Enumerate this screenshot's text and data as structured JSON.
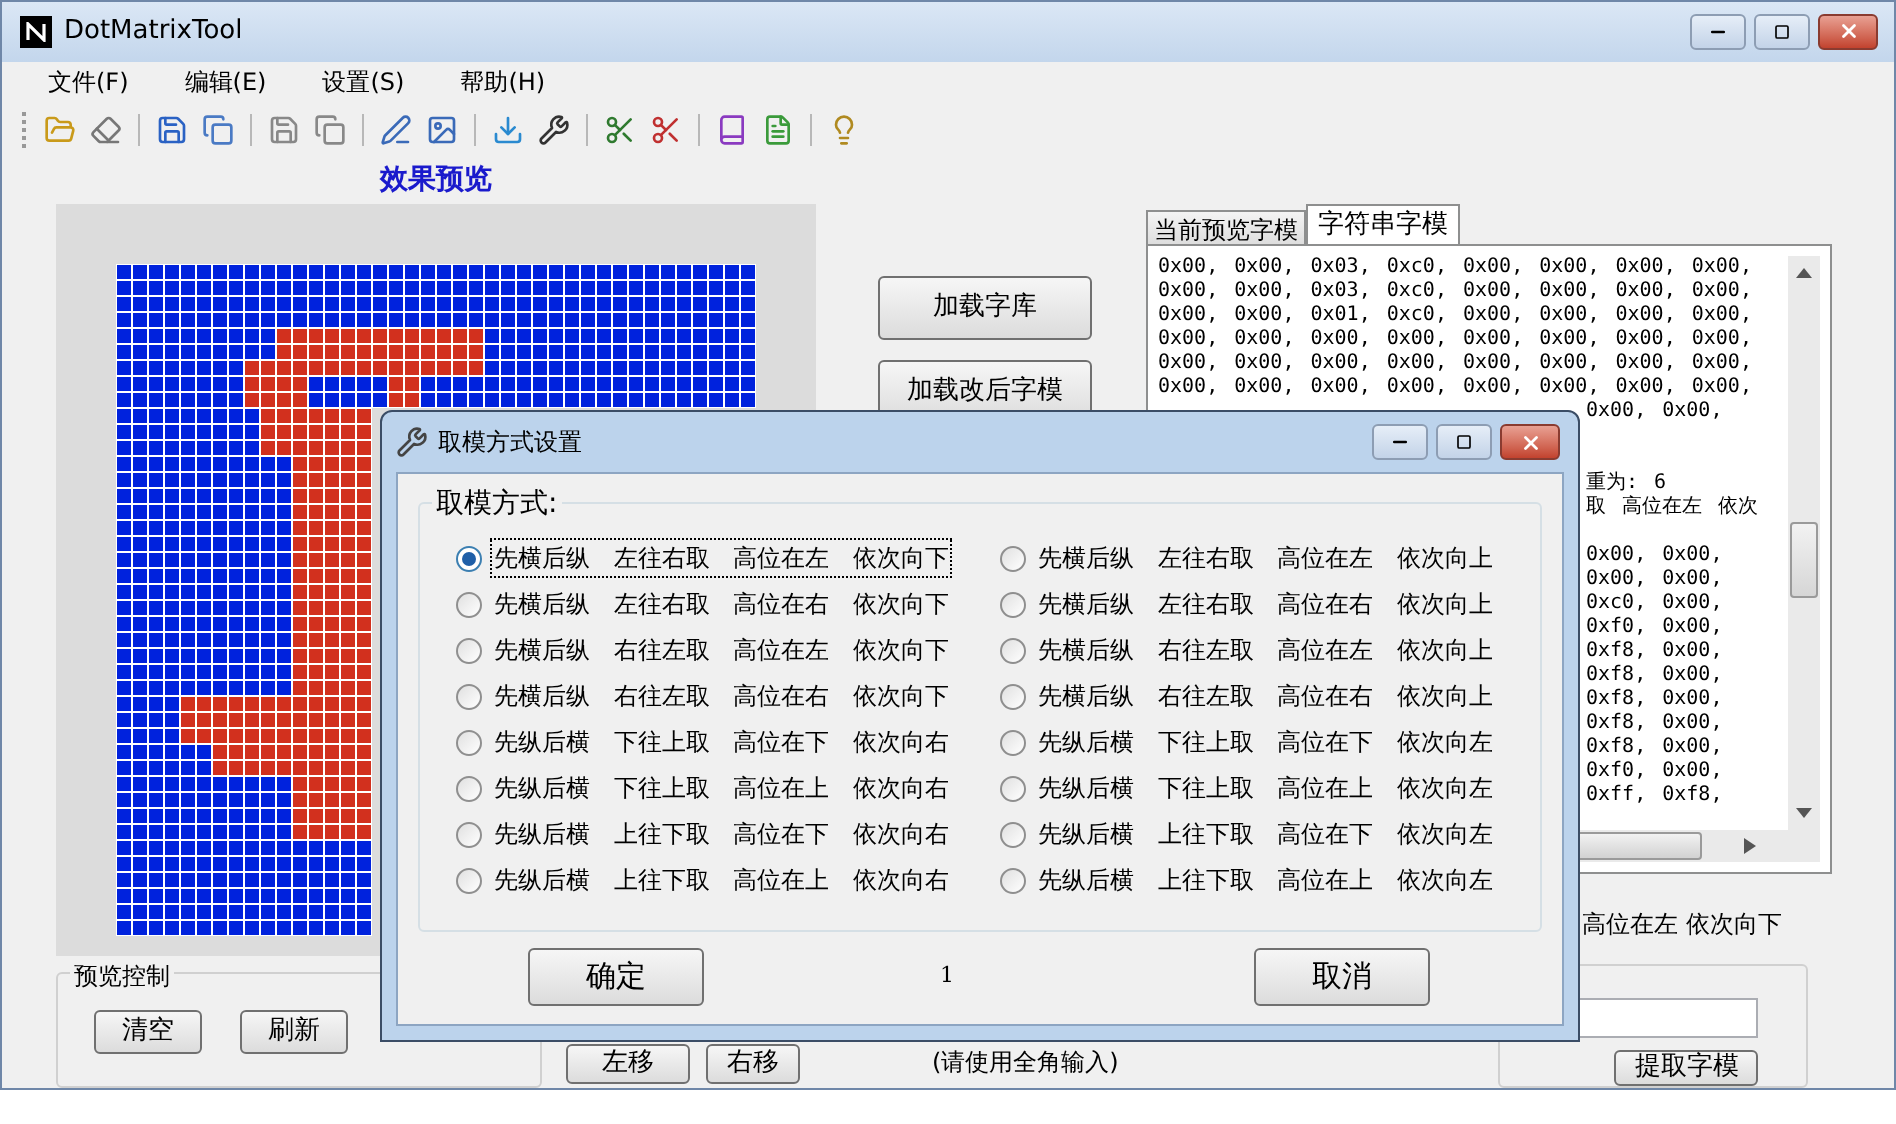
{
  "window": {
    "title": "DotMatrixTool"
  },
  "menu": [
    {
      "label": "文件(F)"
    },
    {
      "label": "编辑(E)"
    },
    {
      "label": "设置(S)"
    },
    {
      "label": "帮助(H)"
    }
  ],
  "preview": {
    "title": "效果预览"
  },
  "side_buttons": [
    "加载字库",
    "加载改后字模"
  ],
  "tabs": [
    {
      "label": "当前预览字模",
      "selected": false
    },
    {
      "label": "字符串字模",
      "selected": true
    }
  ],
  "output_lines": [
    {
      "kind": "full",
      "text": "0x00, 0x00, 0x03, 0xc0, 0x00, 0x00, 0x00, 0x00,"
    },
    {
      "kind": "full",
      "text": "0x00, 0x00, 0x03, 0xc0, 0x00, 0x00, 0x00, 0x00,"
    },
    {
      "kind": "full",
      "text": "0x00, 0x00, 0x01, 0xc0, 0x00, 0x00, 0x00, 0x00,"
    },
    {
      "kind": "full",
      "text": "0x00, 0x00, 0x00, 0x00, 0x00, 0x00, 0x00, 0x00,"
    },
    {
      "kind": "full",
      "text": "0x00, 0x00, 0x00, 0x00, 0x00, 0x00, 0x00, 0x00,"
    },
    {
      "kind": "full",
      "text": "0x00, 0x00, 0x00, 0x00, 0x00, 0x00, 0x00, 0x00,"
    },
    {
      "kind": "tail",
      "text": "0x00, 0x00,"
    },
    {
      "kind": "gap"
    },
    {
      "kind": "gap"
    },
    {
      "kind": "tail",
      "text": "重为: 6"
    },
    {
      "kind": "tail",
      "text": "取 高位在左 依次"
    },
    {
      "kind": "gap"
    },
    {
      "kind": "tail",
      "text": "0x00, 0x00,"
    },
    {
      "kind": "tail",
      "text": "0x00, 0x00,"
    },
    {
      "kind": "tail",
      "text": "0xc0, 0x00,"
    },
    {
      "kind": "tail",
      "text": "0xf0, 0x00,"
    },
    {
      "kind": "tail",
      "text": "0xf8, 0x00,"
    },
    {
      "kind": "tail",
      "text": "0xf8, 0x00,"
    },
    {
      "kind": "tail",
      "text": "0xf8, 0x00,"
    },
    {
      "kind": "tail",
      "text": "0xf8, 0x00,"
    },
    {
      "kind": "tail",
      "text": "0xf8, 0x00,"
    },
    {
      "kind": "tail",
      "text": "0xf0, 0x00,"
    },
    {
      "kind": "tail",
      "text": "0xff, 0xf8,"
    }
  ],
  "status_text": "高位在左 依次向下",
  "preview_control": {
    "title": "预览控制",
    "buttons": [
      "清空",
      "刷新"
    ]
  },
  "shift_buttons": [
    "左移",
    "右移"
  ],
  "hint": "(请使用全角输入)",
  "extract_button": "提取字模",
  "dialog": {
    "title": "取模方式设置",
    "group_title": "取模方式:",
    "options": [
      {
        "label": "先横后纵 左往右取 高位在左 依次向下",
        "selected": true
      },
      {
        "label": "先横后纵 左往右取 高位在左 依次向上",
        "selected": false
      },
      {
        "label": "先横后纵 左往右取 高位在右 依次向下",
        "selected": false
      },
      {
        "label": "先横后纵 左往右取 高位在右 依次向上",
        "selected": false
      },
      {
        "label": "先横后纵 右往左取 高位在左 依次向下",
        "selected": false
      },
      {
        "label": "先横后纵 右往左取 高位在左 依次向上",
        "selected": false
      },
      {
        "label": "先横后纵 右往左取 高位在右 依次向下",
        "selected": false
      },
      {
        "label": "先横后纵 右往左取 高位在右 依次向上",
        "selected": false
      },
      {
        "label": "先纵后横 下往上取 高位在下 依次向右",
        "selected": false
      },
      {
        "label": "先纵后横 下往上取 高位在下 依次向左",
        "selected": false
      },
      {
        "label": "先纵后横 下往上取 高位在上 依次向右",
        "selected": false
      },
      {
        "label": "先纵后横 下往上取 高位在上 依次向左",
        "selected": false
      },
      {
        "label": "先纵后横 上往下取 高位在下 依次向右",
        "selected": false
      },
      {
        "label": "先纵后横 上往下取 高位在下 依次向左",
        "selected": false
      },
      {
        "label": "先纵后横 上往下取 高位在上 依次向右",
        "selected": false
      },
      {
        "label": "先纵后横 上往下取 高位在上 依次向左",
        "selected": false
      }
    ],
    "ok": "确定",
    "value": "1",
    "cancel": "取消"
  }
}
